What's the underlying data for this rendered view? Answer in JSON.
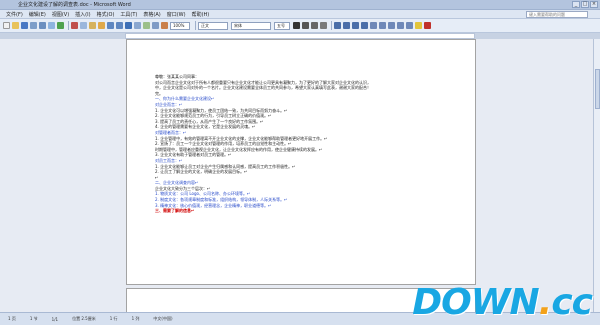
{
  "window": {
    "title": "企业文化建设了解的调查表.doc - Microsoft Word",
    "min": "_",
    "max": "□",
    "close": "×"
  },
  "menu": {
    "items": [
      "文件(F)",
      "编辑(E)",
      "视图(V)",
      "插入(I)",
      "格式(O)",
      "工具(T)",
      "表格(A)",
      "窗口(W)",
      "帮助(H)"
    ],
    "help_placeholder": "键入需要帮助的问题"
  },
  "toolbar": {
    "zoom": "100%",
    "style": "正文",
    "font": "宋体",
    "size": "五号"
  },
  "document": {
    "lines": [
      {
        "text": "尊敬：张某某公司同事：",
        "style": ""
      },
      {
        "text": "  对公司而言企业文化对于所有人都很重要只有企业文化才能让公司更具有凝聚力，为了更好的了解大家对企业文化的认识，",
        "style": ""
      },
      {
        "text": "中，企业文化是公司对外的一个名片。企业文化建设需要全体员工的共同参与，希望大家认真填写此表，谢谢大家的配合！",
        "style": ""
      },
      {
        "text": "完。",
        "style": ""
      },
      {
        "text": "一、你为什么需要企业文化建设↵",
        "style": "h"
      },
      {
        "text": "对企业而言：↵",
        "style": "h"
      },
      {
        "text": "1. 企业文化可以增强凝聚力，使员工团结一致，为共同目标而努力奋斗。↵",
        "style": ""
      },
      {
        "text": "2. 企业文化能够规范员工的行为，引导员工树立正确的价值观。↵",
        "style": ""
      },
      {
        "text": "3. 提高了员工的责任心，从而产生了一个良好的工作氛围。↵",
        "style": ""
      },
      {
        "text": "4. 企业的管理需要有企业文化，它是企业发展的灵魂。↵",
        "style": ""
      },
      {
        "text": "对管理者而言：↵",
        "style": "h"
      },
      {
        "text": "1. 企业管理中，有效的管理离不开企业文化的支撑，企业文化能够帮助管理者更好地开展工作。↵",
        "style": ""
      },
      {
        "text": "2. 宣扬了：员工一个企业文化对管理的作用，培养员工的自觉性和主动性。↵",
        "style": ""
      },
      {
        "text": "   时期管理中，管理者应重视企业文化，让企业文化发挥应有的作用，使企业健康持续的发展。↵",
        "style": ""
      },
      {
        "text": "3. 企业文化有助于管理者对员工的管理。↵",
        "style": ""
      },
      {
        "text": "对员工而言：↵",
        "style": "h"
      },
      {
        "text": "1. 企业文化能够让员工对企业产生归属感和认同感，提高员工的工作积极性。↵",
        "style": ""
      },
      {
        "text": "2. 让员工了解企业的文化，明确企业的发展目标。↵",
        "style": ""
      },
      {
        "text": "  ↵",
        "style": ""
      },
      {
        "text": "二、企业文化调查内容↵",
        "style": "h"
      },
      {
        "text": "企业文化大致分为三个层次：↵",
        "style": ""
      },
      {
        "text": "1. 物质文化：公司 Logo、公司名称、办公环境等。↵",
        "style": "h"
      },
      {
        "text": "2. 制度文化：各项规章制度和标准，组织结构，领导体制，人际关系等。↵",
        "style": "h"
      },
      {
        "text": "3. 精神文化：核心价值观，经营理念，企业精神，职业道德等。↵",
        "style": "h"
      },
      {
        "text": "三、需要了解的信息↵",
        "style": "hr"
      }
    ]
  },
  "status": {
    "page": "1 页",
    "section": "1 节",
    "pages": "1/1",
    "position": "位置 2.5厘米",
    "line": "1 行",
    "col": "1 列",
    "lang": "中文(中国)"
  },
  "watermark": {
    "main": "DOWN",
    "dot": ".",
    "suffix": "cc"
  }
}
